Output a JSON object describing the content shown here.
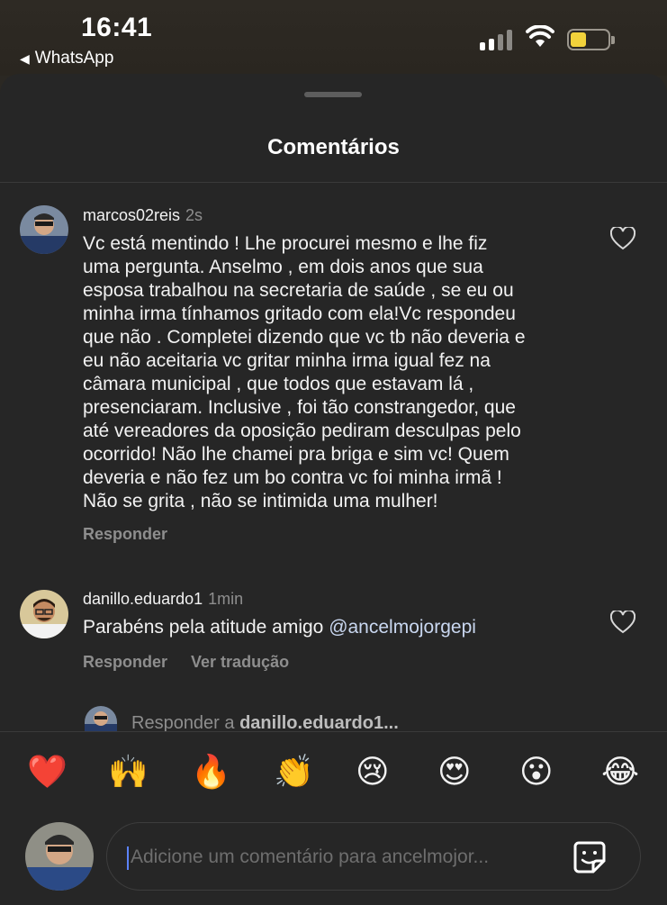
{
  "status_bar": {
    "time": "16:41",
    "back_app": "WhatsApp",
    "battery_color": "#f2d23b"
  },
  "sheet": {
    "title": "Comentários"
  },
  "comments": [
    {
      "username": "marcos02reis",
      "time_ago": "2s",
      "lines": [
        "Vc está mentindo ! Lhe procurei mesmo e lhe fiz",
        "uma pergunta. Anselmo , em dois anos que sua",
        "esposa trabalhou na secretaria de saúde , se eu ou",
        "minha irma tínhamos  gritado com ela!Vc respondeu",
        "que não . Completei dizendo que vc tb não deveria e",
        "eu não aceitaria vc gritar minha irma igual fez na",
        "câmara municipal , que todos que estavam lá ,",
        "presenciaram. Inclusive , foi tão constrangedor, que",
        "até vereadores da oposição pediram desculpas pelo",
        "ocorrido! Não lhe chamei pra briga e sim vc! Quem",
        "deveria e não fez um bo contra vc foi minha irmã !",
        "Não se grita , não se intimida uma mulher!"
      ],
      "reply_label": "Responder"
    },
    {
      "username": "danillo.eduardo1",
      "time_ago": "1min",
      "text_prefix": "Parabéns pela atitude amigo ",
      "mention": "@ancelmojorgepi",
      "reply_label": "Responder",
      "translate_label": "Ver tradução"
    }
  ],
  "reply_bar": {
    "prefix": "Responder a ",
    "target": "danillo.eduardo1..."
  },
  "emojis": [
    "❤️",
    "🙌",
    "🔥",
    "👏",
    "😢",
    "😍",
    "😮",
    "😂"
  ],
  "composer": {
    "placeholder": "Adicione um comentário para ancelmojor..."
  },
  "icons": {
    "heart": "heart-icon",
    "sticker": "sticker-icon",
    "back": "back-triangle-icon",
    "signal": "cellular-signal-icon",
    "wifi": "wifi-icon",
    "battery": "battery-icon"
  }
}
